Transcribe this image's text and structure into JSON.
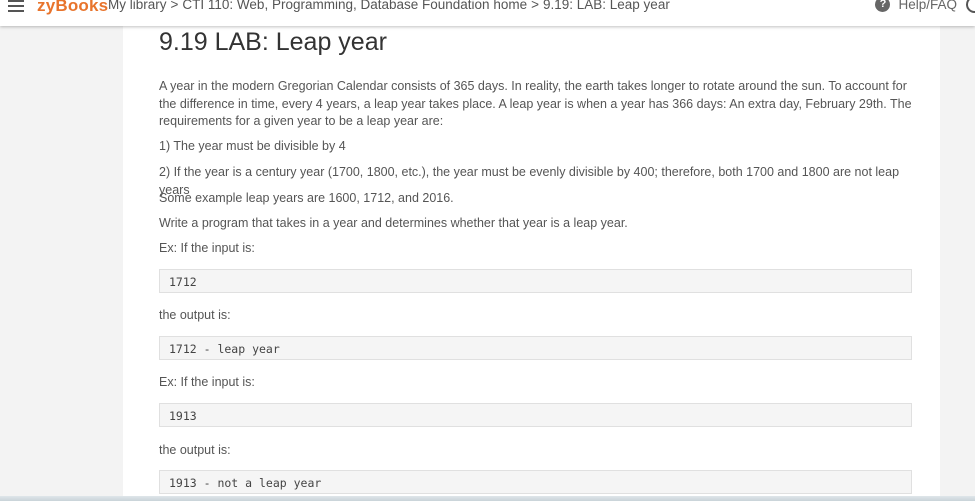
{
  "header": {
    "logo": "zyBooks",
    "breadcrumb": {
      "my_library": "My library",
      "course": "CTI 110: Web, Programming, Database Foundation home",
      "section": "9.19: LAB: Leap year",
      "separator": ">"
    },
    "help_label": "Help/FAQ",
    "help_icon_glyph": "?"
  },
  "lab": {
    "title": "9.19 LAB: Leap year",
    "intro": "A year in the modern Gregorian Calendar consists of 365 days. In reality, the earth takes longer to rotate around the sun. To account for the difference in time, every 4 years, a leap year takes place. A leap year is when a year has 366 days: An extra day, February 29th. The requirements for a given year to be a leap year are:",
    "rule1": "1) The year must be divisible by 4",
    "rule2": "2) If the year is a century year (1700, 1800, etc.), the year must be evenly divisible by 400; therefore, both 1700 and 1800 are not leap years",
    "examples_text": "Some example leap years are 1600, 1712, and 2016.",
    "task": "Write a program that takes in a year and determines whether that year is a leap year.",
    "ex1_input_label": "Ex: If the input is:",
    "ex1_input": "1712",
    "ex1_output_label": "the output is:",
    "ex1_output": "1712 - leap year",
    "ex2_input_label": "Ex: If the input is:",
    "ex2_input": "1913",
    "ex2_output_label": "the output is:",
    "ex2_output": "1913 - not a leap year"
  },
  "colors": {
    "brand": "#e8742c",
    "page_bg": "#f3f3f3",
    "content_bg": "#ffffff",
    "code_bg": "#f5f5f5"
  }
}
